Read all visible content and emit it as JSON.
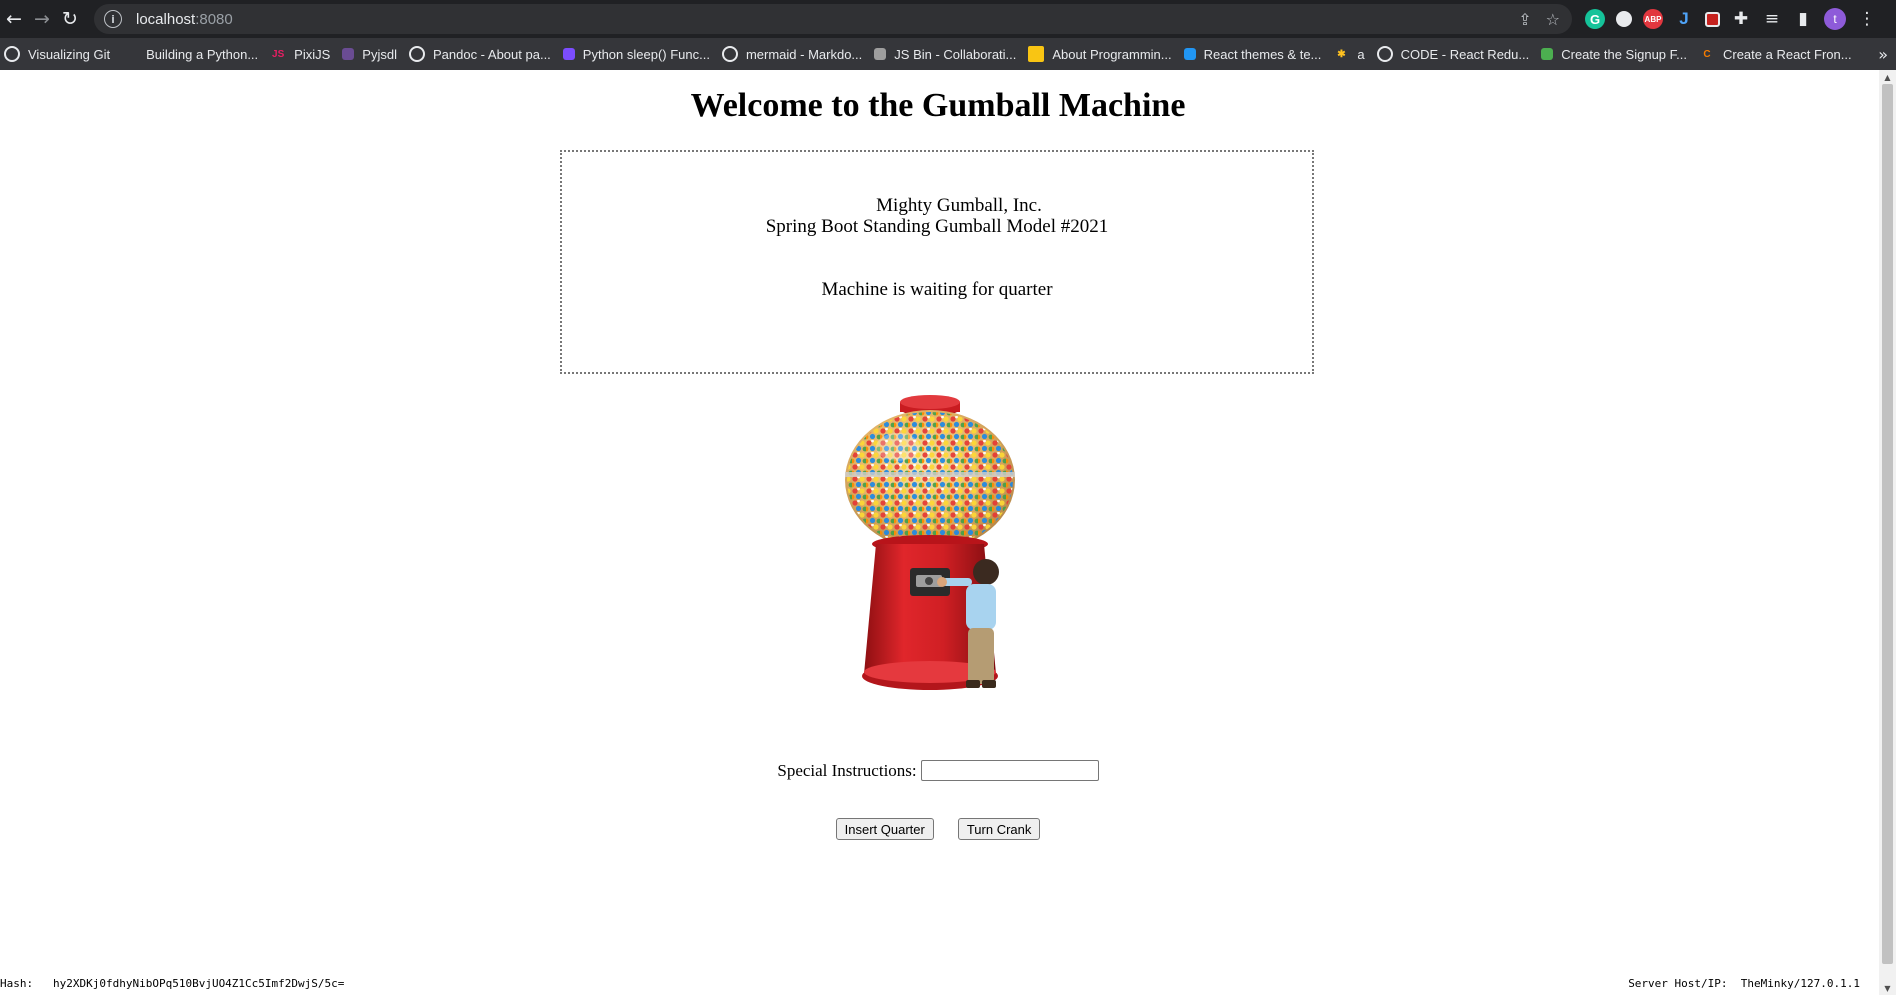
{
  "browser": {
    "url_host": "localhost",
    "url_port": ":8080"
  },
  "bookmarks": [
    {
      "label": "Visualizing Git",
      "icon": "globe-icon",
      "color": "#e8eaed",
      "glyph": ""
    },
    {
      "label": "Building a Python...",
      "icon": "blank-icon",
      "color": "#35363a",
      "glyph": ""
    },
    {
      "label": "PixiJS",
      "icon": "pixijs-icon",
      "color": "#e91e63",
      "glyph": "JS"
    },
    {
      "label": "Pyjsdl",
      "icon": "pyjsdl-icon",
      "color": "#6a4c93",
      "glyph": ""
    },
    {
      "label": "Pandoc - About pa...",
      "icon": "globe-icon",
      "color": "#e8eaed",
      "glyph": ""
    },
    {
      "label": "Python sleep() Func...",
      "icon": "python-icon",
      "color": "#7c4dff",
      "glyph": ""
    },
    {
      "label": "mermaid - Markdo...",
      "icon": "globe-icon",
      "color": "#e8eaed",
      "glyph": ""
    },
    {
      "label": "JS Bin - Collaborati...",
      "icon": "jsbin-icon",
      "color": "#9e9e9e",
      "glyph": ""
    },
    {
      "label": "About Programmin...",
      "icon": "folder-icon",
      "color": "#f9c513",
      "glyph": ""
    },
    {
      "label": "React themes & te...",
      "icon": "mui-icon",
      "color": "#2196f3",
      "glyph": ""
    },
    {
      "label": "a",
      "icon": "walmart-icon",
      "color": "#ffc220",
      "glyph": "✱"
    },
    {
      "label": "CODE - React Redu...",
      "icon": "globe-icon",
      "color": "#e8eaed",
      "glyph": ""
    },
    {
      "label": "Create the Signup F...",
      "icon": "leaf-icon",
      "color": "#4caf50",
      "glyph": ""
    },
    {
      "label": "Create a React Fron...",
      "icon": "c-icon",
      "color": "#f57c00",
      "glyph": "C"
    }
  ],
  "page": {
    "title": "Welcome to the Gumball Machine",
    "company": "Mighty Gumball, Inc.",
    "model": "Spring Boot Standing Gumball Model #2021",
    "state": "Machine is waiting for quarter",
    "instructions_label": "Special Instructions:",
    "instructions_value": "",
    "insert_quarter_label": "Insert Quarter",
    "turn_crank_label": "Turn Crank",
    "hash_label": "Hash:",
    "hash_value": "hy2XDKj0fdhyNibOPq510BvjUO4Z1Cc5Imf2DwjS/5c=",
    "server_label": "Server Host/IP:",
    "server_value": "TheMinky/127.0.1.1"
  }
}
